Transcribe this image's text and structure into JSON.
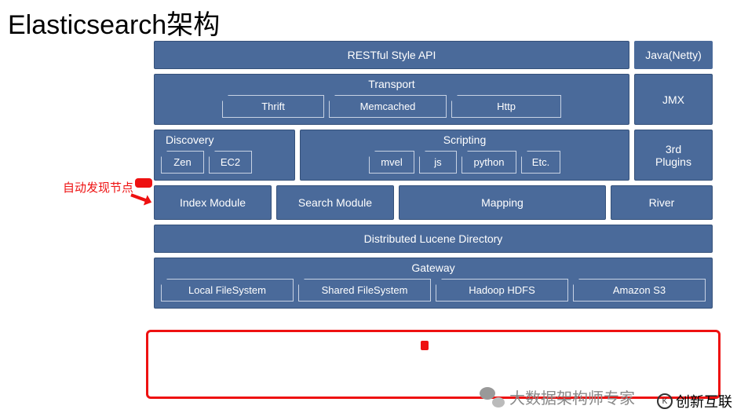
{
  "title": "Elasticsearch架构",
  "annotation": {
    "discovery_note": "自动发现节点"
  },
  "diagram": {
    "row1": {
      "restful": "RESTful Style API",
      "java": "Java(Netty)"
    },
    "row2": {
      "transport": "Transport",
      "transport_subs": [
        "Thrift",
        "Memcached",
        "Http"
      ],
      "jmx": "JMX"
    },
    "row3": {
      "discovery": "Discovery",
      "discovery_subs": [
        "Zen",
        "EC2"
      ],
      "scripting": "Scripting",
      "scripting_subs": [
        "mvel",
        "js",
        "python",
        "Etc."
      ],
      "plugins_top": "3rd",
      "plugins_bottom": "Plugins"
    },
    "row4": {
      "index_module": "Index Module",
      "search_module": "Search Module",
      "mapping": "Mapping",
      "river": "River"
    },
    "row5": {
      "lucene": "Distributed Lucene Directory"
    },
    "row6": {
      "gateway": "Gateway",
      "gateway_subs": [
        "Local FileSystem",
        "Shared FileSystem",
        "Hadoop HDFS",
        "Amazon S3"
      ]
    }
  },
  "footer": {
    "wechat_text": "大数据架构师专家",
    "logo_text": "创新互联"
  }
}
